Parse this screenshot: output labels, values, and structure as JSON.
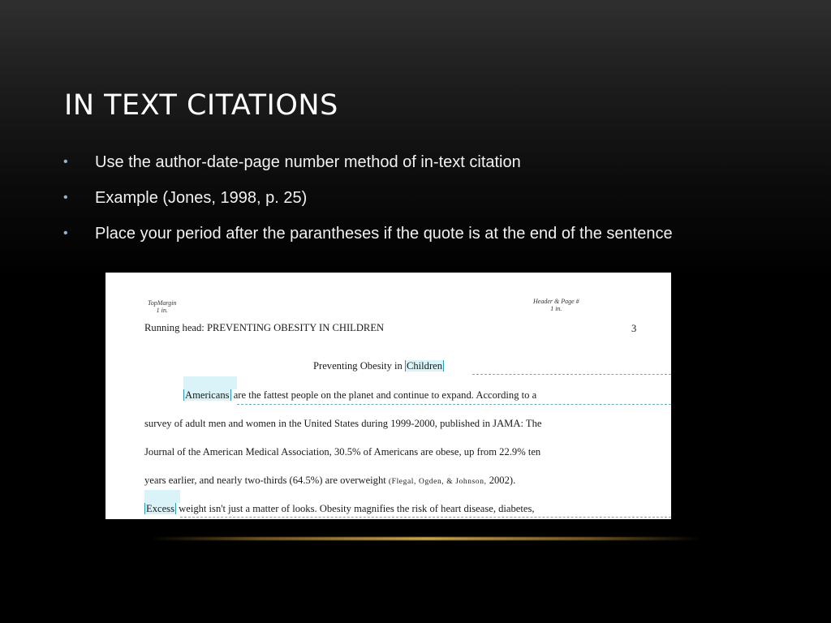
{
  "slide": {
    "title": "IN TEXT CITATIONS",
    "bullet_glyph": "•",
    "bullets": [
      "Use the author-date-page number method of in-text citation",
      "Example (Jones, 1998, p. 25)",
      "Place your period after the parantheses if the quote is at the end of the sentence"
    ]
  },
  "document": {
    "annotations": {
      "top_margin": [
        "TopMargin",
        "1 in."
      ],
      "header_page": [
        "Header & Page #",
        "1 in."
      ]
    },
    "running_head": "Running head: PREVENTING OBESITY IN CHILDREN",
    "page_number": "3",
    "title_prefix": "Preventing Obesity in ",
    "title_highlight": "Children",
    "lines": {
      "l1_highlight": "Americans",
      "l1_rest": " are the fattest people on the planet and continue to expand.  According to a",
      "l2": "survey of adult men and women in the United States during 1999-2000, published in JAMA: The",
      "l3": "Journal of the American Medical Association, 30.5% of Americans are obese, up from 22.9% ten",
      "l4_main": "years earlier, and nearly two-thirds (64.5%) are overweight ",
      "l4_cite": "(Flegal, Ogden, & Johnson,",
      "l4_end": " 2002).",
      "l5_highlight": "Excess",
      "l5_rest": " weight isn't just a matter of looks.  Obesity magnifies the risk of heart disease, diabetes,"
    }
  },
  "colors": {
    "bullet": "#8fb6d9",
    "title": "#ffffff",
    "highlight": "#d9f3f8",
    "rule_gold": "#c9a44e"
  }
}
